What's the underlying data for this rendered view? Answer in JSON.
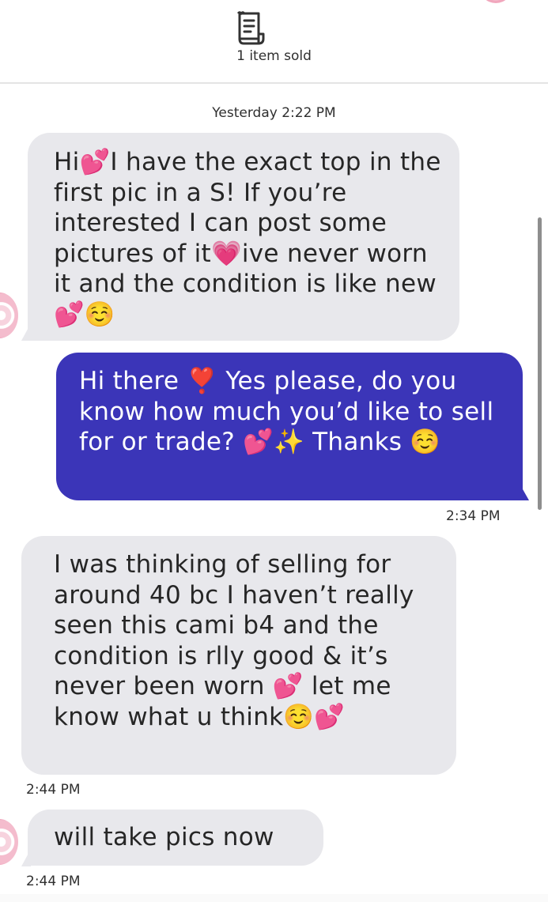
{
  "header": {
    "sold_text": "1 item sold",
    "icon": "receipt-icon"
  },
  "conversation": {
    "date_divider": "Yesterday 2:22 PM",
    "messages": [
      {
        "direction": "incoming",
        "text": "Hi💕I have the exact top in the first pic in a S! If you’re interested I can post some pictures of it💗ive never worn it and the condition is like new💕☺️",
        "time": ""
      },
      {
        "direction": "outgoing",
        "text": "Hi there ❣️ Yes please, do you know how much you’d like to sell for or trade? 💕✨ Thanks ☺️",
        "time": "2:34 PM"
      },
      {
        "direction": "incoming",
        "text": "I was thinking of selling for around 40 bc I haven’t really seen this cami b4 and the condition is rlly good & it’s never been worn 💕 let me know what u think☺️💕",
        "time": "2:44 PM"
      },
      {
        "direction": "incoming",
        "text": "will take pics now",
        "time": "2:44 PM"
      }
    ]
  },
  "colors": {
    "outgoing_bubble": "#3b35b8",
    "incoming_bubble": "#e8e8ec",
    "text": "#262626"
  }
}
